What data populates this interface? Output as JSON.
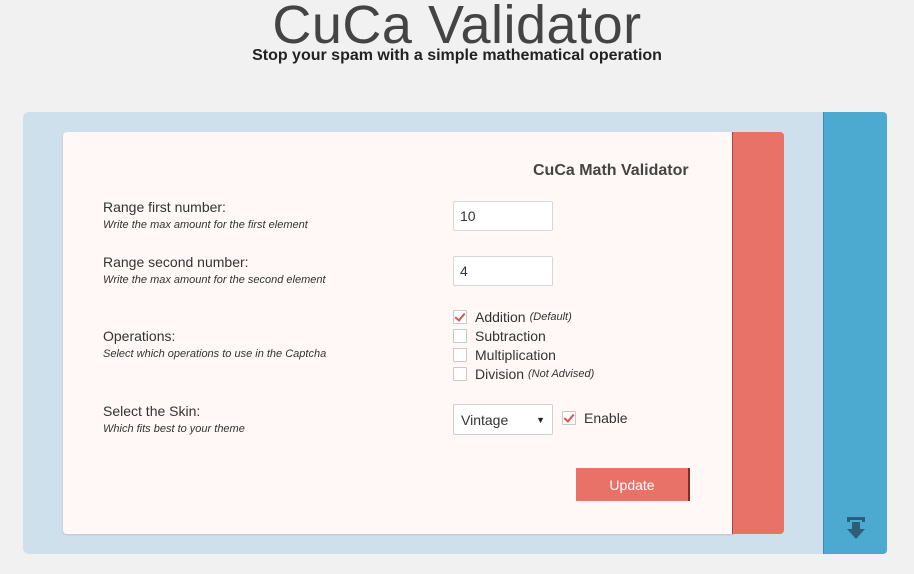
{
  "header": {
    "title": "CuCa Validator",
    "subtitle": "Stop your spam with a simple mathematical operation"
  },
  "card": {
    "title": "CuCa Math Validator",
    "range_first": {
      "label": "Range first number:",
      "hint": "Write the max amount for the first element",
      "value": "10"
    },
    "range_second": {
      "label": "Range second number:",
      "hint": "Write the max amount for the second element",
      "value": "4"
    },
    "operations": {
      "label": "Operations:",
      "hint": "Select which operations to use in the Captcha",
      "items": [
        {
          "label": "Addition",
          "note": "(Default)",
          "checked": true
        },
        {
          "label": "Subtraction",
          "note": "",
          "checked": false
        },
        {
          "label": "Multiplication",
          "note": "",
          "checked": false
        },
        {
          "label": "Division",
          "note": "(Not Advised)",
          "checked": false
        }
      ]
    },
    "skin": {
      "label": "Select the Skin:",
      "hint": "Which fits best to your theme",
      "selected": "Vintage",
      "enable_label": "Enable",
      "enable_checked": true
    },
    "update_label": "Update"
  },
  "colors": {
    "accent_red": "#e87168",
    "accent_blue": "#4ca9d0",
    "panel_bg": "#cde0ec",
    "check_mark": "#d9534f"
  },
  "icons": {
    "sidebar_bottom": "download-arrow-icon"
  }
}
